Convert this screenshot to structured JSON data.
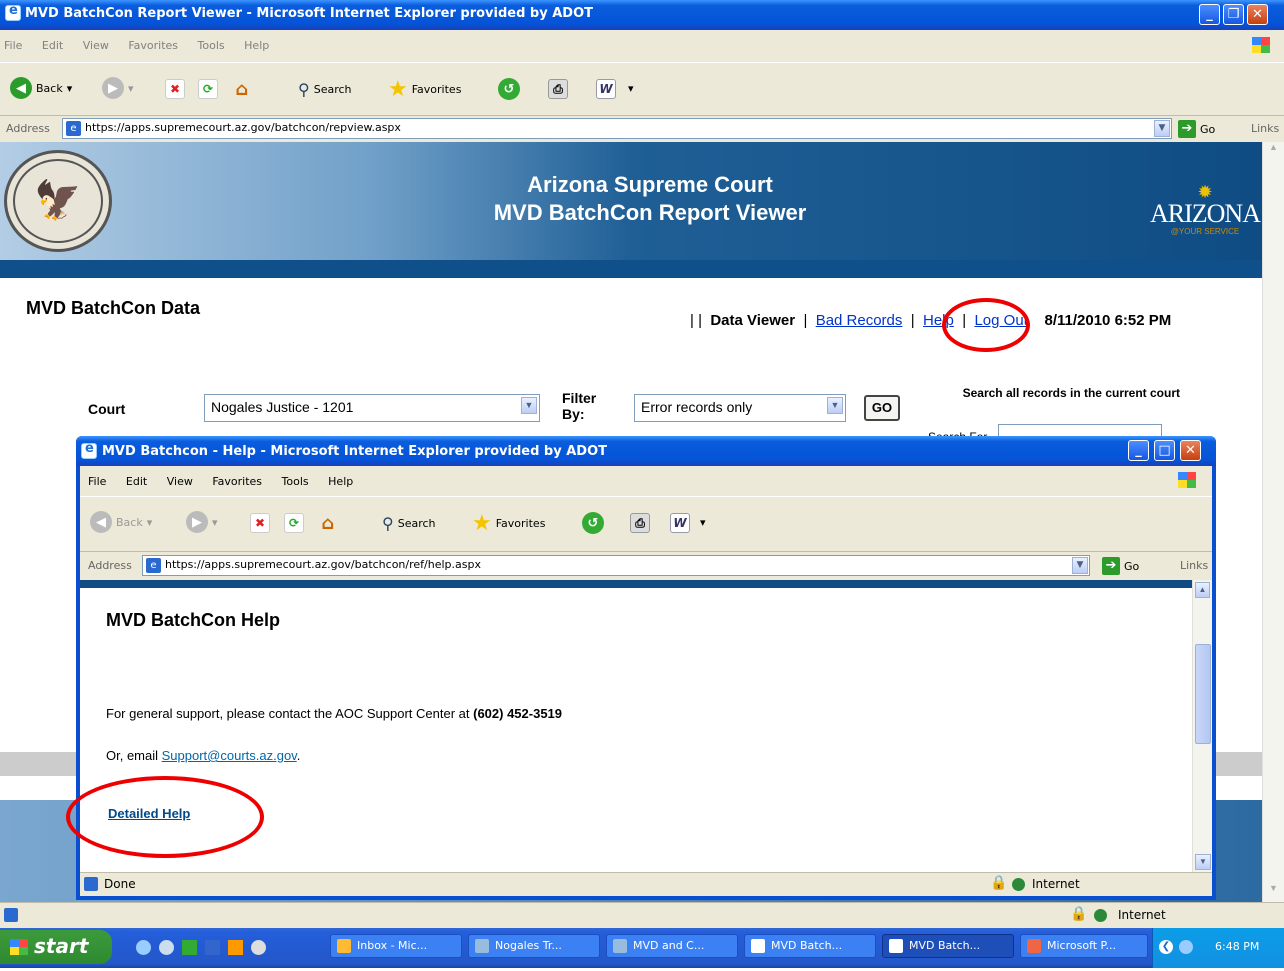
{
  "outer": {
    "title": "MVD BatchCon Report Viewer - Microsoft Internet Explorer provided by ADOT",
    "menu": [
      "File",
      "Edit",
      "View",
      "Favorites",
      "Tools",
      "Help"
    ],
    "toolbar": {
      "back": "Back",
      "search": "Search",
      "favorites": "Favorites"
    },
    "address_label": "Address",
    "url": "https://apps.supremecourt.az.gov/batchcon/repview.aspx",
    "go": "Go",
    "links": "Links",
    "status_zone": "Internet"
  },
  "banner": {
    "line1": "Arizona Supreme Court",
    "line2": "MVD BatchCon Report Viewer",
    "logo_text": "ARIZONA",
    "logo_sub": "@YOUR SERVICE"
  },
  "page": {
    "title": "MVD BatchCon Data",
    "nav_sep": "| |",
    "nav_data_viewer": "Data Viewer",
    "nav_bar": "|",
    "nav_bad_records": "Bad Records",
    "nav_help": "Help",
    "nav_logout": "Log Out",
    "datetime": "8/11/2010 6:52 PM",
    "court_label": "Court",
    "court_value": "Nogales Justice - 1201",
    "filter_label": "Filter By:",
    "filter_value": "Error records only",
    "go_button": "GO",
    "search_note": "Search all records in the current court",
    "search_for": "Search For"
  },
  "popup": {
    "title": "MVD Batchcon - Help - Microsoft Internet Explorer provided by ADOT",
    "menu": [
      "File",
      "Edit",
      "View",
      "Favorites",
      "Tools",
      "Help"
    ],
    "toolbar": {
      "back": "Back",
      "search": "Search",
      "favorites": "Favorites"
    },
    "address_label": "Address",
    "url": "https://apps.supremecourt.az.gov/batchcon/ref/help.aspx",
    "go": "Go",
    "links": "Links",
    "heading": "MVD BatchCon Help",
    "support_text": "For general support, please contact the AOC Support Center at ",
    "support_phone": "(602) 452-3519",
    "email_prefix": "Or, email ",
    "email": "Support@courts.az.gov",
    "email_suffix": ".",
    "detailed_help": "Detailed Help",
    "status": "Done",
    "status_zone": "Internet"
  },
  "taskbar": {
    "start": "start",
    "buttons": [
      "Inbox - Mic...",
      "Nogales Tr...",
      "MVD and C...",
      "MVD Batch...",
      "MVD Batch...",
      "Microsoft P..."
    ],
    "clock": "6:48 PM"
  }
}
